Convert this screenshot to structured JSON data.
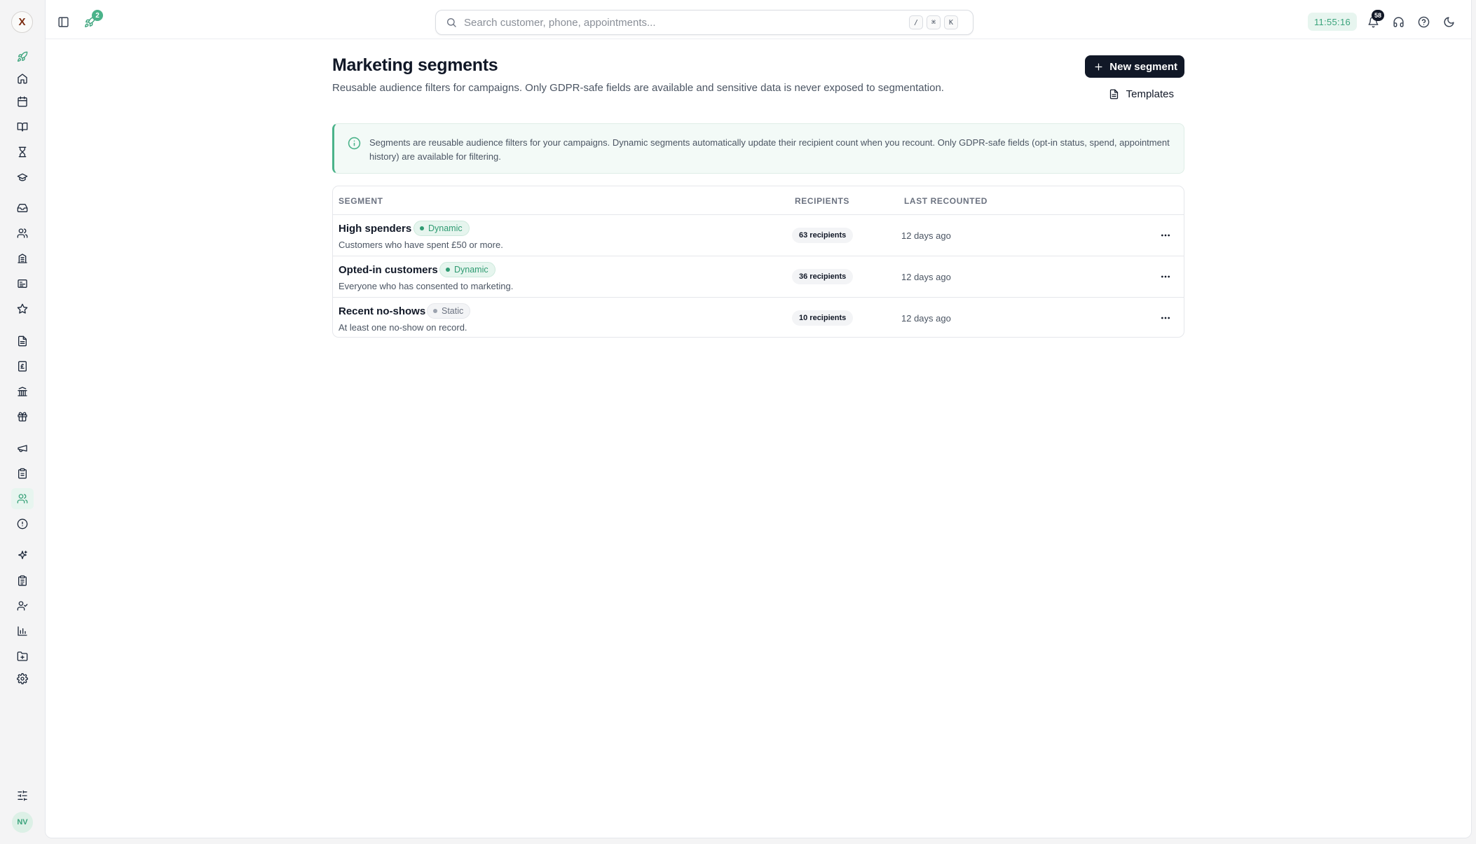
{
  "app": {
    "logo_text": "X",
    "user_initials": "NV",
    "accent_color": "#3aa37b"
  },
  "sidebar": {
    "items": [
      {
        "name": "rocket-icon",
        "accent": true
      },
      {
        "name": "home-icon"
      },
      {
        "name": "calendar-icon"
      },
      {
        "name": "book-open-icon"
      },
      {
        "name": "hourglass-icon"
      },
      {
        "name": "graduation-cap-icon"
      },
      {
        "name": "inbox-icon"
      },
      {
        "name": "users-icon"
      },
      {
        "name": "building-icon"
      },
      {
        "name": "id-card-icon"
      },
      {
        "name": "star-icon"
      },
      {
        "name": "file-text-icon"
      },
      {
        "name": "pound-receipt-icon"
      },
      {
        "name": "bank-icon"
      },
      {
        "name": "gift-icon"
      },
      {
        "name": "megaphone-icon"
      },
      {
        "name": "clipboard-icon"
      },
      {
        "name": "users-segments-icon",
        "active": true
      },
      {
        "name": "alert-circle-icon"
      },
      {
        "name": "sparkles-icon"
      },
      {
        "name": "clipboard-list-icon"
      },
      {
        "name": "user-check-icon"
      },
      {
        "name": "bar-chart-icon"
      },
      {
        "name": "folder-icon"
      },
      {
        "name": "settings-icon"
      },
      {
        "name": "sliders-icon"
      }
    ]
  },
  "topbar": {
    "rocket_badge": "2",
    "search_placeholder": "Search customer, phone, appointments...",
    "shortcut_keys": [
      "/",
      "⌘",
      "K"
    ],
    "clock": "11:55:16",
    "notifications_count": "58"
  },
  "page": {
    "title": "Marketing segments",
    "subtitle": "Reusable audience filters for campaigns. Only GDPR-safe fields are available and sensitive data is never exposed to segmentation.",
    "new_button": "New segment",
    "templates_button": "Templates",
    "info_text": "Segments are reusable audience filters for your campaigns. Dynamic segments automatically update their recipient count when you recount. Only GDPR-safe fields (opt-in status, spend, appointment history) are available for filtering."
  },
  "table": {
    "headers": {
      "segment": "SEGMENT",
      "recipients": "RECIPIENTS",
      "last_recounted": "LAST RECOUNTED"
    },
    "rows": [
      {
        "name": "High spenders",
        "type": "Dynamic",
        "description": "Customers who have spent £50 or more.",
        "recipients": "63 recipients",
        "last_recounted": "12 days ago"
      },
      {
        "name": "Opted-in customers",
        "type": "Dynamic",
        "description": "Everyone who has consented to marketing.",
        "recipients": "36 recipients",
        "last_recounted": "12 days ago"
      },
      {
        "name": "Recent no-shows",
        "type": "Static",
        "description": "At least one no-show on record.",
        "recipients": "10 recipients",
        "last_recounted": "12 days ago"
      }
    ]
  }
}
